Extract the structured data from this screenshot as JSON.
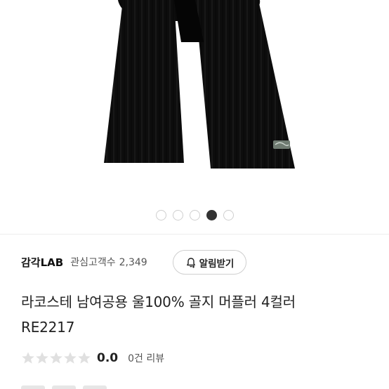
{
  "carousel": {
    "total": 5,
    "active_index": 3
  },
  "seller": {
    "name": "감각LAB",
    "followers_label": "관심고객수",
    "followers_count": "2,349"
  },
  "notify_button": {
    "label": "알림받기",
    "icon": "bell-plus-icon"
  },
  "product": {
    "title_line1": "라코스테 남여공용 울100% 골지 머플러 4컬러",
    "title_line2": "RE2217"
  },
  "rating": {
    "stars": 0,
    "max_stars": 5,
    "score": "0.0",
    "reviews_label": "0건 리뷰"
  },
  "colors": {
    "scarf": "#0d0d0d",
    "star_empty": "#e0e0e0",
    "dot_active": "#333333"
  }
}
